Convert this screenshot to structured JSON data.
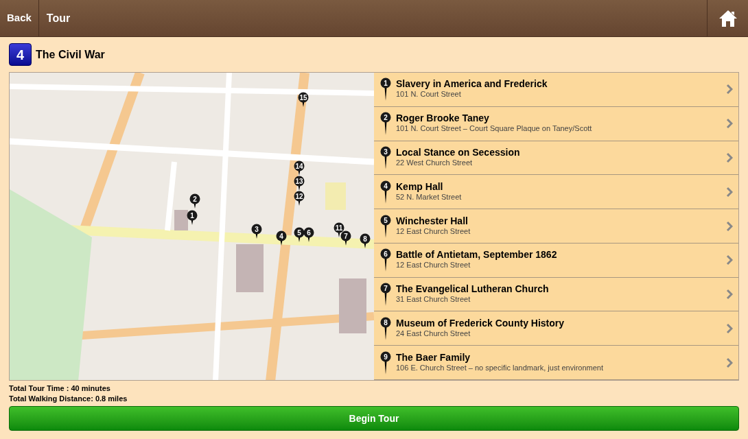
{
  "header": {
    "back": "Back",
    "title": "Tour"
  },
  "tour": {
    "number": "4",
    "title": "The Civil War"
  },
  "map_pins": [
    "15",
    "14",
    "13",
    "2",
    "12",
    "1",
    "3",
    "4",
    "5",
    "6",
    "11",
    "7",
    "8"
  ],
  "stops": [
    {
      "number": "1",
      "title": "Slavery in America and Frederick",
      "address": "101 N. Court Street"
    },
    {
      "number": "2",
      "title": "Roger Brooke Taney",
      "address": "101 N. Court Street – Court Square Plaque on Taney/Scott"
    },
    {
      "number": "3",
      "title": "Local Stance on Secession",
      "address": "22 West Church Street"
    },
    {
      "number": "4",
      "title": "Kemp Hall",
      "address": "52 N. Market Street"
    },
    {
      "number": "5",
      "title": "Winchester Hall",
      "address": "12 East Church Street"
    },
    {
      "number": "6",
      "title": "Battle of Antietam, September 1862",
      "address": "12 East Church Street"
    },
    {
      "number": "7",
      "title": "The Evangelical Lutheran Church",
      "address": "31 East Church Street"
    },
    {
      "number": "8",
      "title": "Museum of Frederick County History",
      "address": "24 East Church Street"
    },
    {
      "number": "9",
      "title": "The Baer Family",
      "address": "106 E. Church Street – no specific landmark, just environment"
    }
  ],
  "totals": [
    "Total Tour Time : 40 minutes",
    "Total Walking Distance: 0.8 miles"
  ],
  "begin_button": "Begin Tour"
}
